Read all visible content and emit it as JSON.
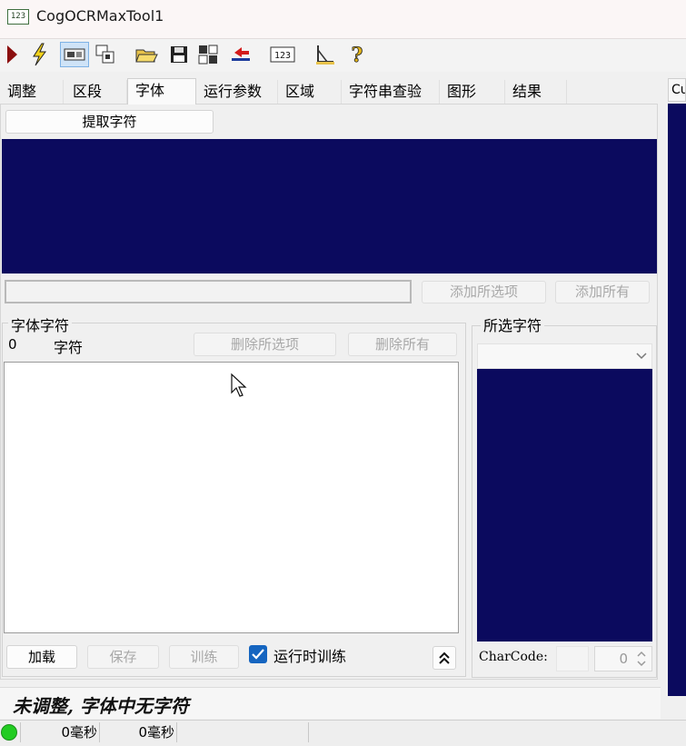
{
  "window": {
    "title": "CogOCRMaxTool1",
    "icon_text": "123"
  },
  "toolbar": {
    "items": [
      {
        "name": "run-icon"
      },
      {
        "name": "electric-icon"
      },
      {
        "name": "display-icon"
      },
      {
        "name": "image-window-icon"
      },
      {
        "name": "open-folder-icon"
      },
      {
        "name": "save-icon"
      },
      {
        "name": "reset-icon"
      },
      {
        "name": "reload-icon"
      },
      {
        "name": "ocr-icon",
        "text": "123"
      },
      {
        "name": "calibrate-icon"
      },
      {
        "name": "help-icon"
      }
    ]
  },
  "tabs": [
    "调整",
    "区段",
    "字体",
    "运行参数",
    "区域",
    "字符串查验",
    "图形",
    "结果"
  ],
  "selected_tab": "字体",
  "side_tab_label": "Cu",
  "font": {
    "extract_button": "提取字符",
    "add_selected": "添加所选项",
    "add_all": "添加所有",
    "font_chars_group": "字体字符",
    "count": "0",
    "chars_header": "字符",
    "delete_selected": "删除所选项",
    "delete_all": "删除所有",
    "selected_chars_group": "所选字符",
    "load": "加载",
    "save": "保存",
    "train": "训练",
    "train_at_runtime": "运行时训练",
    "train_at_runtime_checked": true,
    "charcode_label": "CharCode:",
    "charcode_value": "0",
    "collapse_glyph": "⌃"
  },
  "status": {
    "message": "未调整, 字体中无字符"
  },
  "statusbar": {
    "time1": "0毫秒",
    "time2": "0毫秒",
    "indicator_color": "#22cc22"
  },
  "colors": {
    "preview_bg": "#0b0a5e"
  }
}
